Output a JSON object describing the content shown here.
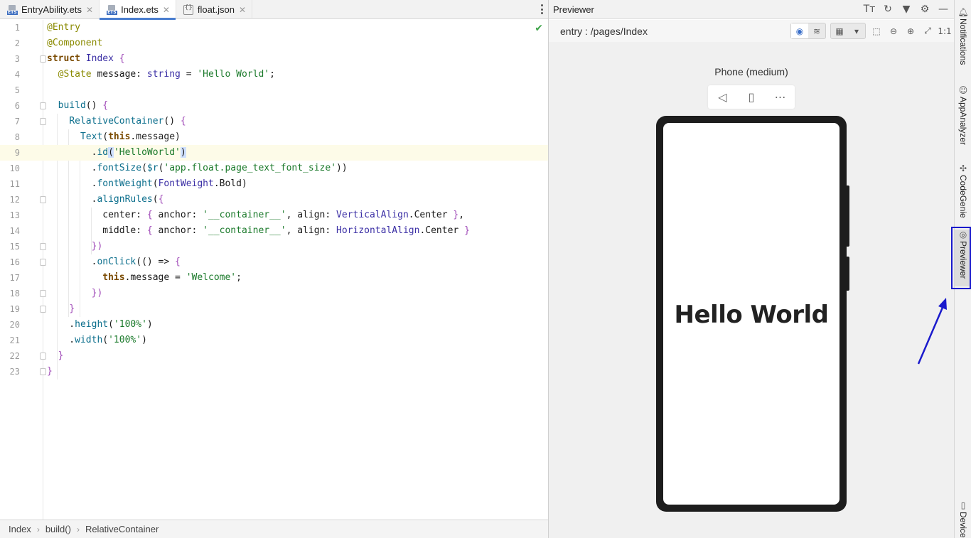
{
  "editor": {
    "tabs": [
      {
        "label": "EntryAbility.ets",
        "icon": "ets-file-icon"
      },
      {
        "label": "Index.ets",
        "icon": "ets-file-icon",
        "active": true
      },
      {
        "label": "float.json",
        "icon": "json-file-icon"
      }
    ],
    "lines": [
      {
        "n": "1",
        "html": "<span class=\"an\">@Entry</span>"
      },
      {
        "n": "2",
        "html": "<span class=\"an\">@Component</span>"
      },
      {
        "n": "3",
        "html": "<span class=\"kw\">struct</span> <span class=\"ty\">Index</span> <span class=\"p\">{</span>"
      },
      {
        "n": "4",
        "html": "  <span class=\"an\">@State</span> message: <span class=\"ty\">string</span> = <span class=\"s\">'Hello World'</span>;"
      },
      {
        "n": "5",
        "html": ""
      },
      {
        "n": "6",
        "html": "  <span class=\"fn\">build</span>() <span class=\"p\">{</span>"
      },
      {
        "n": "7",
        "html": "    <span class=\"fn\">RelativeContainer</span>() <span class=\"p\">{</span>"
      },
      {
        "n": "8",
        "html": "      <span class=\"fn\">Text</span>(<span class=\"kw\">this</span>.message)"
      },
      {
        "n": "9",
        "html": "        .<span class=\"fn\">id</span><span class=\"hl\">(</span><span class=\"s\">'HelloWorld'</span><span class=\"hl\">)</span>"
      },
      {
        "n": "10",
        "html": "        .<span class=\"fn\">fontSize</span>(<span class=\"fn\">$r</span>(<span class=\"s\">'app.float.page_text_font_size'</span>))"
      },
      {
        "n": "11",
        "html": "        .<span class=\"fn\">fontWeight</span>(<span class=\"ty\">FontWeight</span>.Bold)"
      },
      {
        "n": "12",
        "html": "        .<span class=\"fn\">alignRules</span>(<span class=\"p\">{</span>"
      },
      {
        "n": "13",
        "html": "          center: <span class=\"p\">{</span> anchor: <span class=\"s\">'__container__'</span>, align: <span class=\"ty\">VerticalAlign</span>.Center <span class=\"p\">}</span>,"
      },
      {
        "n": "14",
        "html": "          middle: <span class=\"p\">{</span> anchor: <span class=\"s\">'__container__'</span>, align: <span class=\"ty\">HorizontalAlign</span>.Center <span class=\"p\">}</span>"
      },
      {
        "n": "15",
        "html": "        <span class=\"p\">})</span>"
      },
      {
        "n": "16",
        "html": "        .<span class=\"fn\">onClick</span>(() => <span class=\"p\">{</span>"
      },
      {
        "n": "17",
        "html": "          <span class=\"kw\">this</span>.message = <span class=\"s\">'Welcome'</span>;"
      },
      {
        "n": "18",
        "html": "        <span class=\"p\">})</span>"
      },
      {
        "n": "19",
        "html": "    <span class=\"p\">}</span>"
      },
      {
        "n": "20",
        "html": "    .<span class=\"fn\">height</span>(<span class=\"s\">'100%'</span>)"
      },
      {
        "n": "21",
        "html": "    .<span class=\"fn\">width</span>(<span class=\"s\">'100%'</span>)"
      },
      {
        "n": "22",
        "html": "  <span class=\"p\">}</span>"
      },
      {
        "n": "23",
        "html": "<span class=\"p\">}</span>"
      }
    ],
    "current_line": "9",
    "status_icon": "check-icon"
  },
  "breadcrumb": {
    "items": [
      "Index",
      "build()",
      "RelativeContainer"
    ]
  },
  "previewer": {
    "title": "Previewer",
    "page_path": "entry : /pages/Index",
    "device_name": "Phone (medium)",
    "screen_text": "Hello World",
    "zoom_label": "1:1",
    "header_icons": [
      "font-size-icon",
      "refresh-icon",
      "pin-icon",
      "settings-icon",
      "minimize-icon"
    ]
  },
  "side_strip": {
    "items": [
      {
        "label": "Notifications",
        "icon": "bell-icon"
      },
      {
        "label": "AppAnalyzer",
        "icon": "robot-icon"
      },
      {
        "label": "CodeGenie",
        "icon": "genie-icon"
      },
      {
        "label": "Previewer",
        "icon": "eye-icon",
        "selected": true
      },
      {
        "label": "Device",
        "icon": "device-icon"
      }
    ]
  },
  "annotation": {
    "color": "#1a1acc"
  }
}
